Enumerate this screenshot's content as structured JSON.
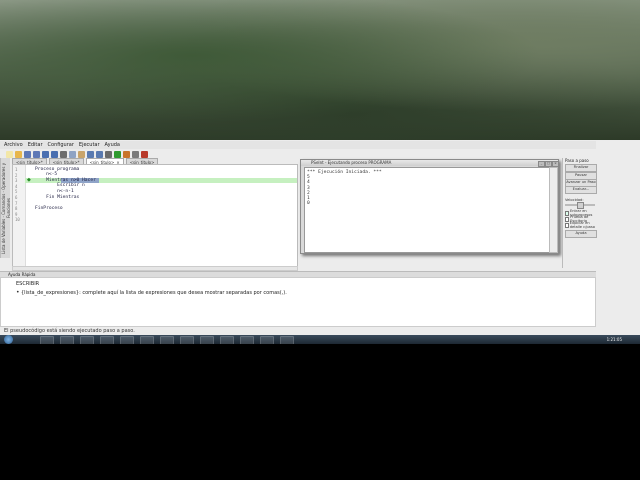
{
  "menubar": [
    "Archivo",
    "Editar",
    "Configurar",
    "Ejecutar",
    "Ayuda"
  ],
  "toolbar_icons": [
    {
      "name": "new-file-icon",
      "color": "#f3e7a8"
    },
    {
      "name": "open-icon",
      "color": "#e8b64b"
    },
    {
      "name": "save-icon",
      "color": "#5e78b6"
    },
    {
      "name": "save-as-icon",
      "color": "#5e78b6"
    },
    {
      "name": "undo-icon",
      "color": "#4a6fb0"
    },
    {
      "name": "redo-icon",
      "color": "#4a6fb0"
    },
    {
      "name": "cut-icon",
      "color": "#6d6d6d"
    },
    {
      "name": "copy-icon",
      "color": "#8fa3c4"
    },
    {
      "name": "paste-icon",
      "color": "#c9a46a"
    },
    {
      "name": "indent-icon",
      "color": "#5a7ab0"
    },
    {
      "name": "unindent-icon",
      "color": "#5a7ab0"
    },
    {
      "name": "find-icon",
      "color": "#6b6b6b"
    },
    {
      "name": "run-icon",
      "color": "#2f9a2f"
    },
    {
      "name": "step-icon",
      "color": "#c9742b"
    },
    {
      "name": "debug-icon",
      "color": "#7a7a7a"
    },
    {
      "name": "flowchart-icon",
      "color": "#b83a2a"
    }
  ],
  "tabs": [
    {
      "label": "<sin_titulo>*",
      "active": false
    },
    {
      "label": "<sin_titulo>*",
      "active": false
    },
    {
      "label": "<sin_titulo>",
      "active": true
    },
    {
      "label": "<sin_titulo>",
      "active": false
    }
  ],
  "left_panel_label": "Lista de Variables · Comandos · Operadores y Funciones",
  "editor": {
    "line_numbers": [
      "1",
      "2",
      "3",
      "4",
      "5",
      "6",
      "7",
      "8",
      "9",
      "10"
    ],
    "code": [
      "Proceso programa",
      "    n<-5",
      "    Mientras n>0 Hacer",
      "        Escribir n",
      "        n<-n-1",
      "    Fin Mientras",
      "",
      "FinProceso",
      "",
      ""
    ]
  },
  "console": {
    "title": "PSeInt - Ejecutando proceso PROGRAMA",
    "lines": [
      "*** Ejecución Iniciada. ***",
      "5",
      "4",
      "3",
      "2",
      "1",
      "0"
    ]
  },
  "right_panel": {
    "title": "Paso a paso",
    "buttons": [
      "Finalizar",
      "Pausar",
      "Avanzar un Paso",
      "Evaluar...",
      "Ayuda"
    ],
    "speed_label": "Velocidad:",
    "checkboxes": [
      {
        "label": "Entrar en subprocesos",
        "checked": true
      },
      {
        "label": "Prueba de Escritorio",
        "checked": false
      },
      {
        "label": "Explicar en detalle c/paso",
        "checked": false
      }
    ]
  },
  "help": {
    "header": "Ayuda Rápida",
    "title": "ESCRIBIR",
    "line": "{lista_de_expresiones}: complete aquí la lista de expresiones que desea mostrar separadas por comas(,)."
  },
  "status": "El pseudocódigo está siendo ejecutado paso a paso.",
  "taskbar": {
    "clock": "1:21:05"
  }
}
